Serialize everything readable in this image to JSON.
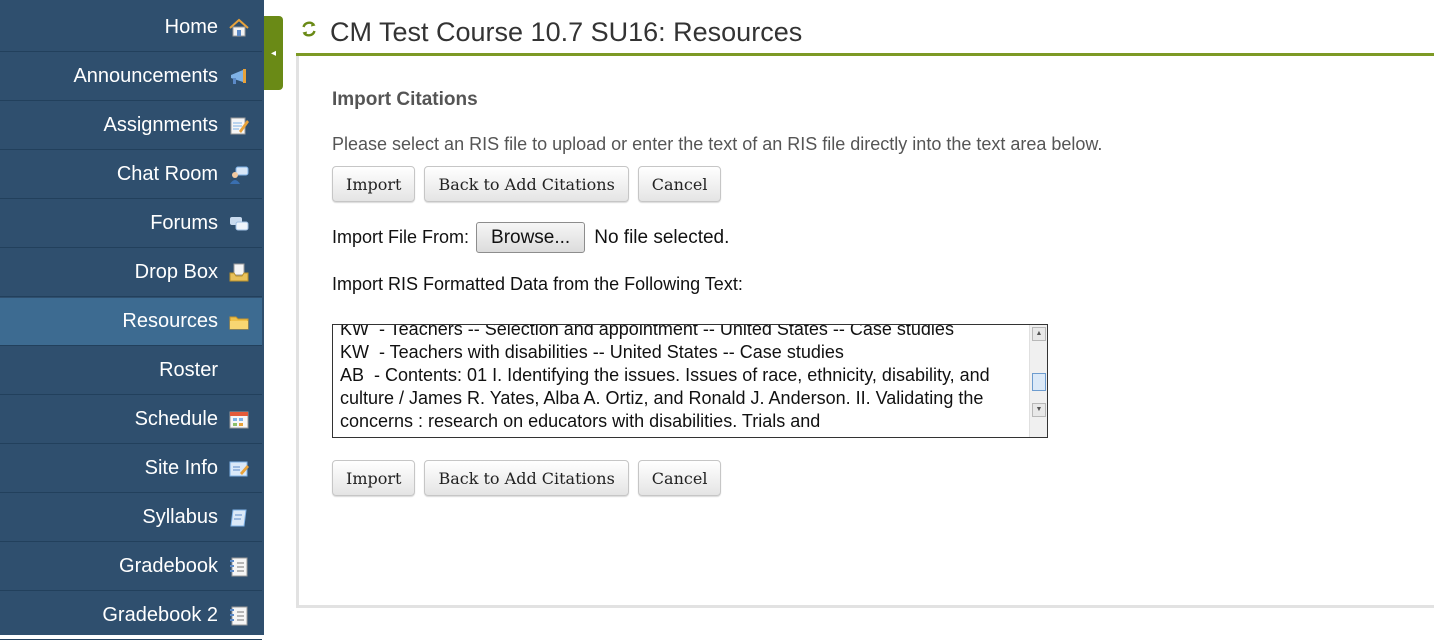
{
  "sidebar": {
    "items": [
      {
        "label": "Home",
        "icon": "home-icon"
      },
      {
        "label": "Announcements",
        "icon": "announcements-icon"
      },
      {
        "label": "Assignments",
        "icon": "assignments-icon"
      },
      {
        "label": "Chat Room",
        "icon": "chat-room-icon"
      },
      {
        "label": "Forums",
        "icon": "forums-icon"
      },
      {
        "label": "Drop Box",
        "icon": "drop-box-icon"
      },
      {
        "label": "Resources",
        "icon": "folder-icon",
        "active": true
      },
      {
        "label": "Roster",
        "icon": ""
      },
      {
        "label": "Schedule",
        "icon": "calendar-icon"
      },
      {
        "label": "Site Info",
        "icon": "site-info-icon"
      },
      {
        "label": "Syllabus",
        "icon": "syllabus-icon"
      },
      {
        "label": "Gradebook",
        "icon": "gradebook-icon"
      },
      {
        "label": "Gradebook 2",
        "icon": "gradebook-icon"
      }
    ],
    "toggle_glyph": "◂"
  },
  "header": {
    "title": "CM Test Course 10.7 SU16: Resources"
  },
  "main": {
    "heading": "Import Citations",
    "instructions": "Please select an RIS file to upload or enter the text of an RIS file directly into the text area below.",
    "buttons": {
      "import": "Import",
      "back": "Back to Add Citations",
      "cancel": "Cancel"
    },
    "file": {
      "label": "Import File From:",
      "browse": "Browse...",
      "status": "No file selected."
    },
    "ris_label": "Import RIS Formatted Data from the Following Text:",
    "ris_text": "KW  - Teachers -- Selection and appointment -- United States -- Case studies\nKW  - Teachers with disabilities -- United States -- Case studies\nAB  - Contents: 01 I. Identifying the issues. Issues of race, ethnicity, disability, and culture / James R. Yates, Alba A. Ortiz, and Ronald J. Anderson. II. Validating the concerns : research on educators with disabilities. Trials and"
  },
  "colors": {
    "sidebar_bg": "#2f4f6e",
    "sidebar_active": "#3d6b91",
    "accent_green": "#7d9a25"
  }
}
